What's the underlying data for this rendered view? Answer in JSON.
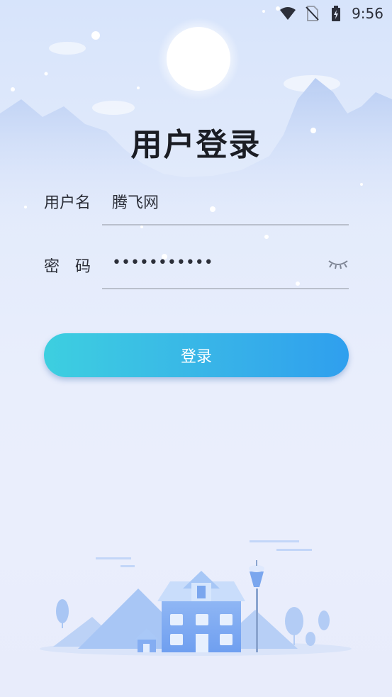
{
  "status_bar": {
    "time": "9:56",
    "icons": [
      "wifi-icon",
      "no-sim-icon",
      "battery-charging-icon"
    ]
  },
  "login": {
    "title": "用户登录",
    "username": {
      "label": "用户名",
      "value": "腾飞网"
    },
    "password": {
      "label": "密　码",
      "value": "•••••••••••",
      "toggle_icon": "eye-closed-icon"
    },
    "submit_label": "登录"
  },
  "colors": {
    "button_start": "#3dcfe0",
    "button_end": "#2f9fee",
    "background_top": "#d7e4fb",
    "background_bottom": "#e8ecfb"
  }
}
